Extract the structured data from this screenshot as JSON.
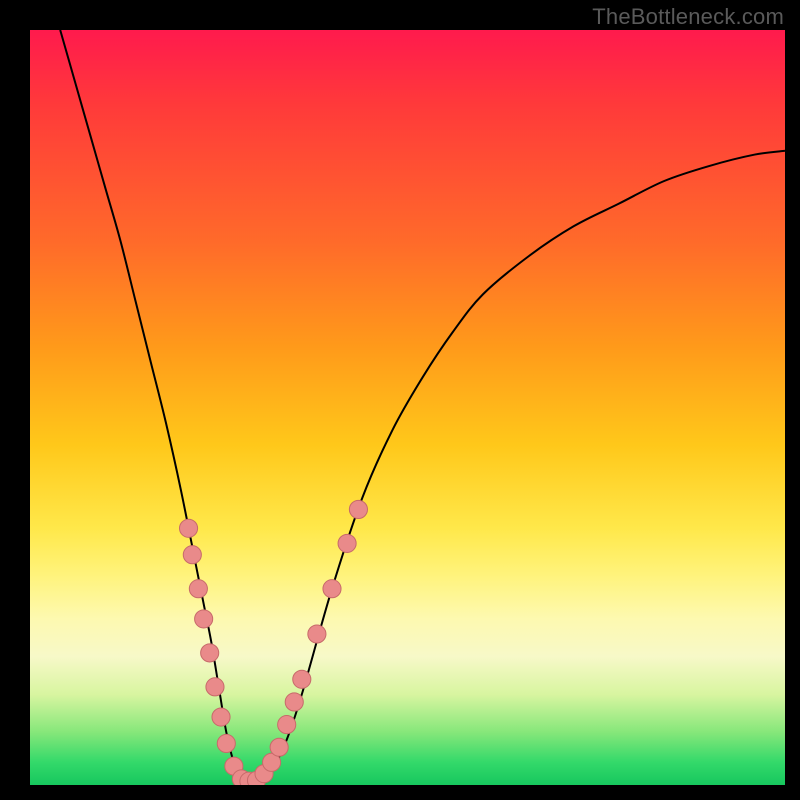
{
  "watermark": "TheBottleneck.com",
  "chart_data": {
    "type": "line",
    "title": "",
    "xlabel": "",
    "ylabel": "",
    "xlim": [
      0,
      100
    ],
    "ylim": [
      0,
      100
    ],
    "grid": false,
    "legend": false,
    "colors": {
      "curve": "#000000",
      "marker_fill": "#e98a8a",
      "marker_stroke": "#c76a6a",
      "gradient_top": "#ff1a4d",
      "gradient_bottom": "#17c75e"
    },
    "series": [
      {
        "name": "bottleneck-curve",
        "x": [
          4,
          6,
          8,
          10,
          12,
          14,
          16,
          18,
          20,
          22,
          23,
          24,
          25,
          26,
          27,
          28,
          29,
          30,
          32,
          34,
          36,
          40,
          44,
          48,
          52,
          56,
          60,
          66,
          72,
          78,
          84,
          90,
          96,
          100
        ],
        "y": [
          100,
          93,
          86,
          79,
          72,
          64,
          56,
          48,
          39,
          29,
          24,
          19,
          13,
          7,
          3,
          1,
          0.5,
          0.5,
          2,
          6,
          12,
          26,
          38,
          47,
          54,
          60,
          65,
          70,
          74,
          77,
          80,
          82,
          83.5,
          84
        ]
      }
    ],
    "markers": [
      {
        "x": 21.0,
        "y": 34.0
      },
      {
        "x": 21.5,
        "y": 30.5
      },
      {
        "x": 22.3,
        "y": 26.0
      },
      {
        "x": 23.0,
        "y": 22.0
      },
      {
        "x": 23.8,
        "y": 17.5
      },
      {
        "x": 24.5,
        "y": 13.0
      },
      {
        "x": 25.3,
        "y": 9.0
      },
      {
        "x": 26.0,
        "y": 5.5
      },
      {
        "x": 27.0,
        "y": 2.5
      },
      {
        "x": 28.0,
        "y": 0.8
      },
      {
        "x": 29.0,
        "y": 0.5
      },
      {
        "x": 30.0,
        "y": 0.6
      },
      {
        "x": 31.0,
        "y": 1.5
      },
      {
        "x": 32.0,
        "y": 3.0
      },
      {
        "x": 33.0,
        "y": 5.0
      },
      {
        "x": 34.0,
        "y": 8.0
      },
      {
        "x": 35.0,
        "y": 11.0
      },
      {
        "x": 36.0,
        "y": 14.0
      },
      {
        "x": 38.0,
        "y": 20.0
      },
      {
        "x": 40.0,
        "y": 26.0
      },
      {
        "x": 42.0,
        "y": 32.0
      },
      {
        "x": 43.5,
        "y": 36.5
      }
    ],
    "marker_radius_pct": 1.2
  }
}
